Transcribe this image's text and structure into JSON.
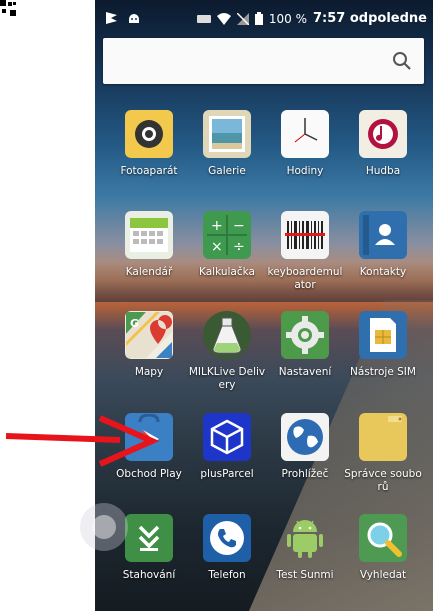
{
  "status_bar": {
    "battery_percent": "100 %",
    "time": "7:57 odpoledne"
  },
  "search": {
    "placeholder": ""
  },
  "apps": [
    {
      "label": "Fotoaparát",
      "icon": "camera-icon"
    },
    {
      "label": "Galerie",
      "icon": "gallery-icon"
    },
    {
      "label": "Hodiny",
      "icon": "clock-icon"
    },
    {
      "label": "Hudba",
      "icon": "music-icon"
    },
    {
      "label": "Kalendář",
      "icon": "calendar-icon"
    },
    {
      "label": "Kalkulačka",
      "icon": "calculator-icon"
    },
    {
      "label": "keyboardemulator",
      "icon": "barcode-icon"
    },
    {
      "label": "Kontakty",
      "icon": "contacts-icon"
    },
    {
      "label": "Mapy",
      "icon": "maps-icon"
    },
    {
      "label": "MILKLive Delivery",
      "icon": "flask-icon"
    },
    {
      "label": "Nastavení",
      "icon": "settings-gear-icon"
    },
    {
      "label": "Nástroje SIM",
      "icon": "sim-card-icon"
    },
    {
      "label": "Obchod Play",
      "icon": "play-store-icon"
    },
    {
      "label": "plusParcel",
      "icon": "parcel-box-icon"
    },
    {
      "label": "Prohlížeč",
      "icon": "globe-icon"
    },
    {
      "label": "Správce souborů",
      "icon": "folder-icon"
    },
    {
      "label": "Stahování",
      "icon": "download-icon"
    },
    {
      "label": "Telefon",
      "icon": "phone-icon"
    },
    {
      "label": "Test Sunmi",
      "icon": "android-icon"
    },
    {
      "label": "Vyhledat",
      "icon": "search-magnifier-icon"
    }
  ],
  "colors": {
    "annotation_arrow": "#e8141c"
  }
}
